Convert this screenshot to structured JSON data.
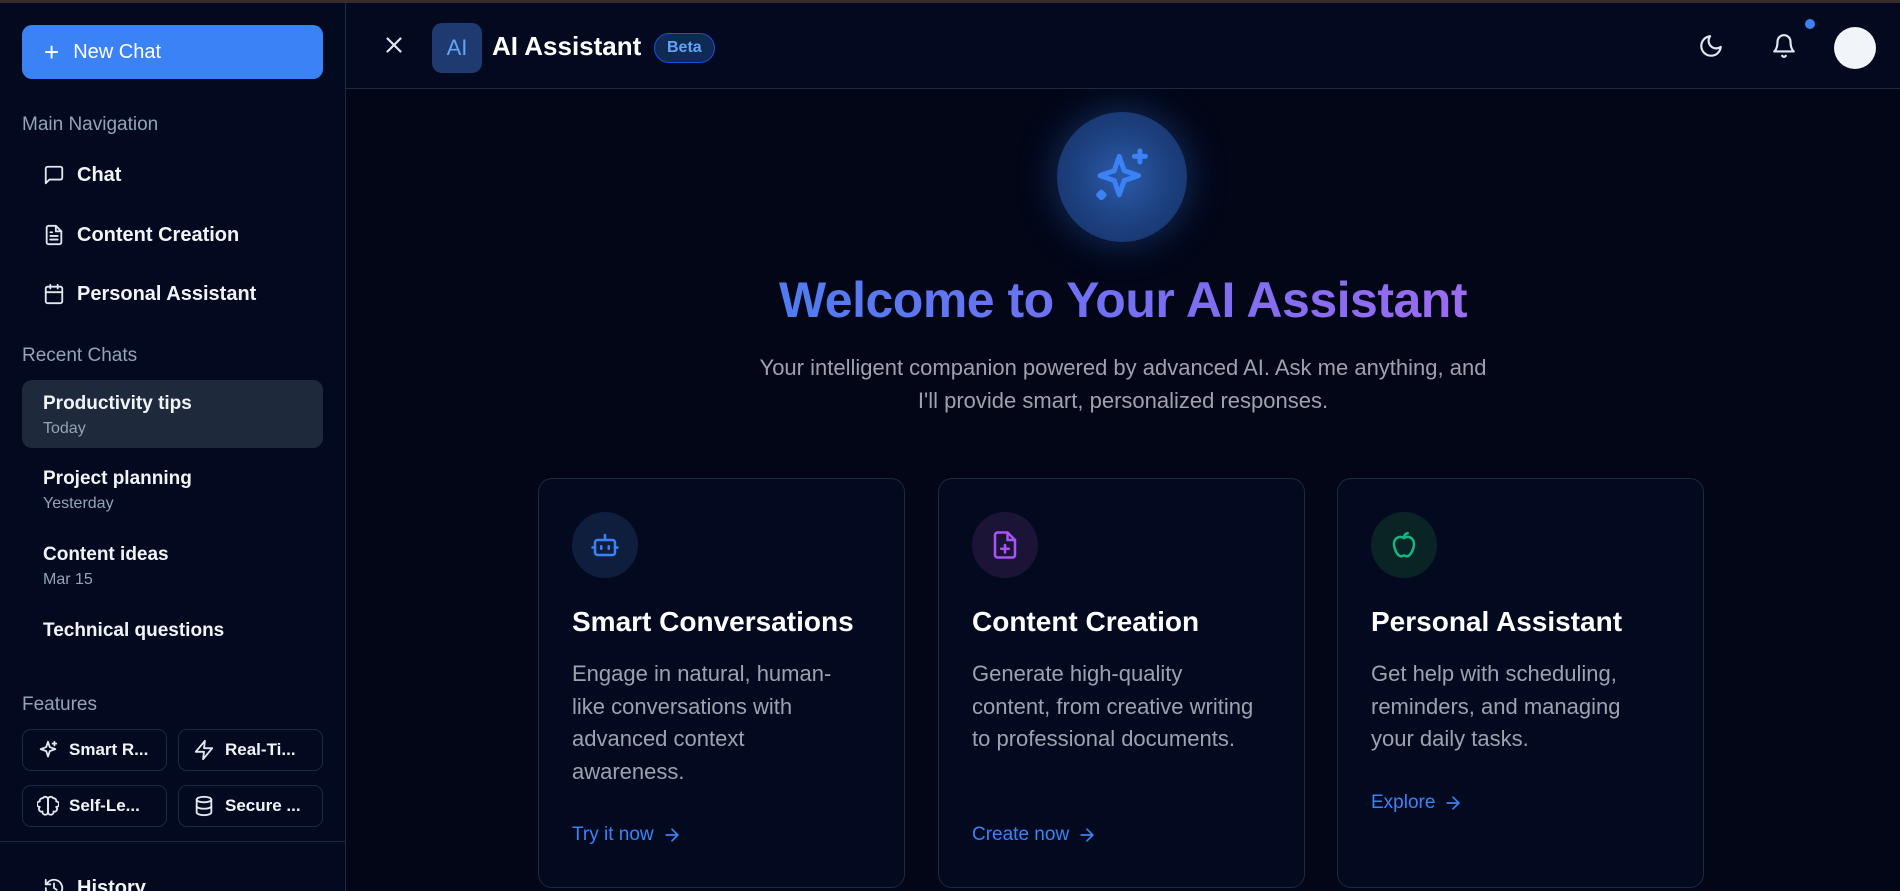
{
  "sidebar": {
    "new_chat_label": "New Chat",
    "main_nav_title": "Main Navigation",
    "nav_items": [
      {
        "label": "Chat",
        "icon": "message-square-icon"
      },
      {
        "label": "Content Creation",
        "icon": "file-text-icon"
      },
      {
        "label": "Personal Assistant",
        "icon": "calendar-icon"
      }
    ],
    "recent_title": "Recent Chats",
    "recent_chats": [
      {
        "title": "Productivity tips",
        "date": "Today",
        "active": true
      },
      {
        "title": "Project planning",
        "date": "Yesterday"
      },
      {
        "title": "Content ideas",
        "date": "Mar 15"
      },
      {
        "title": "Technical questions",
        "date": ""
      }
    ],
    "features_title": "Features",
    "features": [
      {
        "label": "Smart R...",
        "icon": "sparkles-icon"
      },
      {
        "label": "Real-Ti...",
        "icon": "zap-icon"
      },
      {
        "label": "Self-Le...",
        "icon": "brain-icon"
      },
      {
        "label": "Secure ...",
        "icon": "database-icon"
      }
    ],
    "history_label": "History"
  },
  "header": {
    "logo_text": "AI",
    "title": "AI Assistant",
    "badge": "Beta"
  },
  "main": {
    "welcome_title": "Welcome to Your AI Assistant",
    "subtitle_line1": "Your intelligent companion powered by advanced AI. Ask me anything, and",
    "subtitle_line2": "I'll provide smart, personalized responses.",
    "cards": [
      {
        "title": "Smart Conversations",
        "desc": "Engage in natural, human-like conversations with advanced context awareness.",
        "link": "Try it now",
        "icon": "bot-icon",
        "color": "#3b82f6"
      },
      {
        "title": "Content Creation",
        "desc": "Generate high-quality content, from creative writing to professional documents.",
        "link": "Create now",
        "icon": "file-plus-icon",
        "color": "#a855f7"
      },
      {
        "title": "Personal Assistant",
        "desc": "Get help with scheduling, reminders, and managing your daily tasks.",
        "link": "Explore",
        "icon": "apple-icon",
        "color": "#10b981"
      }
    ]
  },
  "colors": {
    "accent": "#3b82f6",
    "background": "#020617",
    "sidebar": "#030a1f"
  }
}
